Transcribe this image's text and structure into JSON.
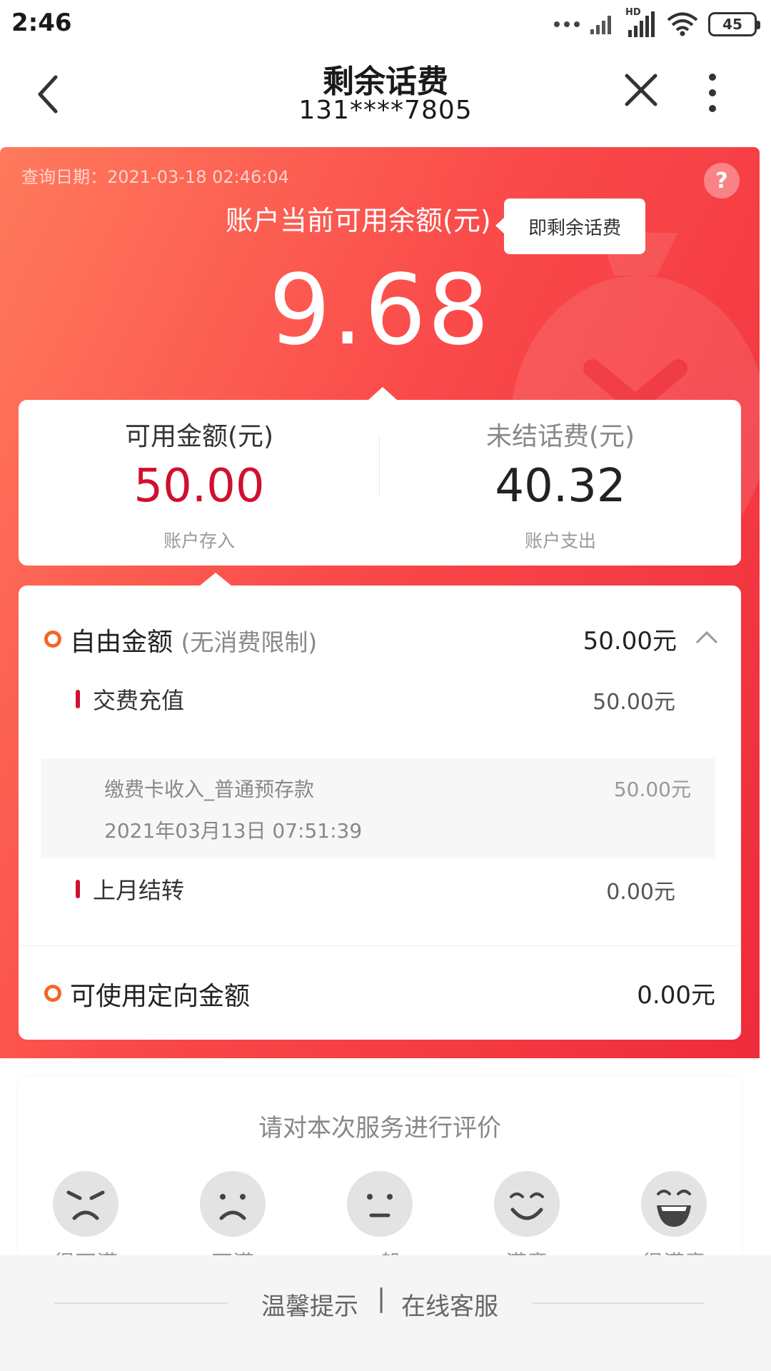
{
  "status_bar": {
    "time": "2:46",
    "battery": "45",
    "hd_label": "HD"
  },
  "nav": {
    "title": "剩余话费",
    "phone": "131****7805"
  },
  "hero": {
    "query_date": "查询日期：2021-03-18 02:46:04",
    "help_label": "?",
    "balance_label": "账户当前可用余额(元)",
    "tooltip": "即剩余话费",
    "balance_value": "9.68",
    "colors": {
      "gradient_start": "#ff7a5c",
      "gradient_end": "#ee2c3c"
    }
  },
  "summary": {
    "available": {
      "title": "可用金额(元)",
      "amount": "50.00",
      "sub": "账户存入",
      "color": "#d0102e"
    },
    "unsettled": {
      "title": "未结话费(元)",
      "amount": "40.32",
      "sub": "账户支出",
      "color": "#222222"
    }
  },
  "detail": {
    "free_amount": {
      "title": "自由金额",
      "note": "(无消费限制)",
      "amount": "50.00元",
      "items": [
        {
          "title": "交费充值",
          "amount": "50.00元",
          "records": [
            {
              "name": "缴费卡收入_普通预存款",
              "time": "2021年03月13日 07:51:39",
              "amount": "50.00元"
            }
          ]
        },
        {
          "title": "上月结转",
          "amount": "0.00元"
        }
      ]
    },
    "directed_amount": {
      "title": "可使用定向金额",
      "amount": "0.00元"
    }
  },
  "rating": {
    "title": "请对本次服务进行评价",
    "options": [
      {
        "label": "很不满",
        "icon": "angry-face-icon"
      },
      {
        "label": "不满",
        "icon": "sad-face-icon"
      },
      {
        "label": "一般",
        "icon": "neutral-face-icon"
      },
      {
        "label": "满意",
        "icon": "smile-face-icon"
      },
      {
        "label": "很满意",
        "icon": "laugh-face-icon"
      }
    ]
  },
  "footer": {
    "tips": "温馨提示",
    "separator": "|",
    "service": "在线客服"
  }
}
